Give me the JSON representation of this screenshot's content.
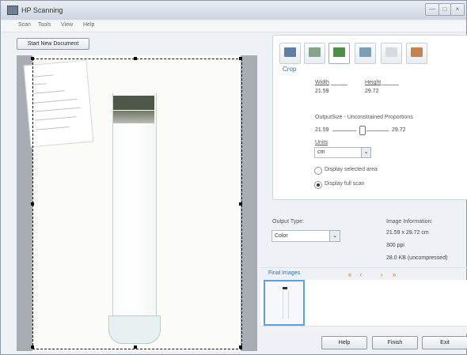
{
  "window": {
    "title": "HP Scanning",
    "buttons": [
      "—",
      "□",
      "×"
    ]
  },
  "menu": [
    "Scan",
    "Tools",
    "View",
    "Help"
  ],
  "toolbar": {
    "start_new_document": "Start New Document"
  },
  "crop": {
    "section_title": "Crop",
    "width_label": "Width",
    "width_value": "21.59",
    "height_label": "Height",
    "height_value": "29.72",
    "output_size_label": "OutputSize - Unconstrained Proportions",
    "output_width": "21.59",
    "output_height": "29.72",
    "units_label": "Units",
    "units_value": "cm",
    "display_selected_area": "Display selected area",
    "display_full_scan": "Display full scan"
  },
  "output": {
    "label": "Output Type:",
    "value": "Color"
  },
  "image_info": {
    "label": "Image Information:",
    "size": "21.59 x 29.72 cm",
    "resolution": "300 ppi",
    "file_size": "28.0 KB (uncompressed)"
  },
  "final_images": {
    "label": "Final Images",
    "nav": [
      "«",
      "‹",
      "›",
      "»"
    ]
  },
  "buttons": {
    "help": "Help",
    "finish": "Finish",
    "exit": "Exit"
  },
  "tabs": [
    {
      "icon": "scanner-icon"
    },
    {
      "icon": "image-adjust-icon"
    },
    {
      "icon": "crop-icon"
    },
    {
      "icon": "resize-icon"
    },
    {
      "icon": "sharpen-icon"
    },
    {
      "icon": "settings-icon"
    }
  ]
}
